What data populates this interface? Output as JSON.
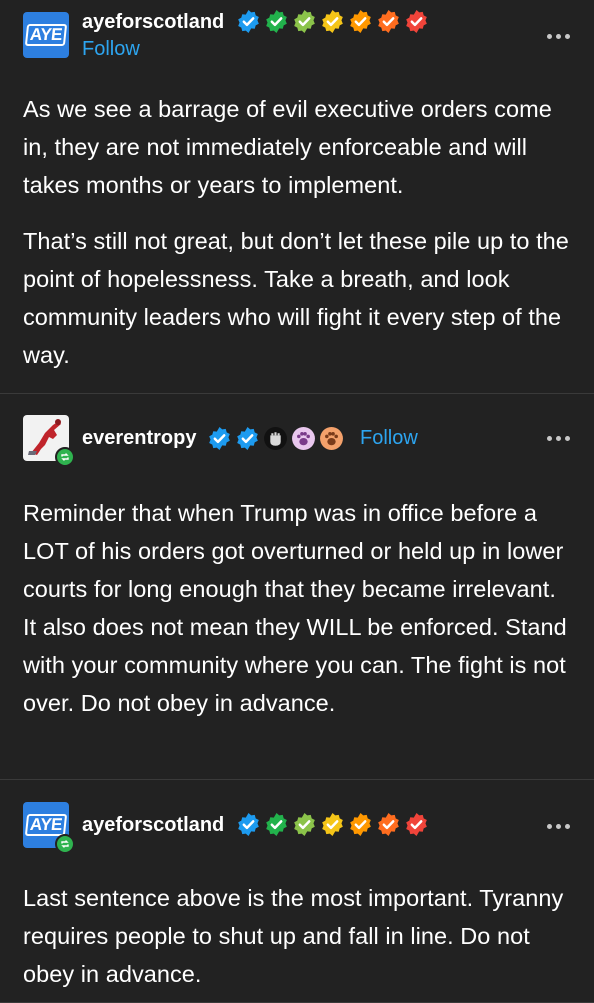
{
  "posts": [
    {
      "username": "ayeforscotland",
      "avatar_text": "AYE",
      "follow_label": "Follow",
      "badges": [
        "verified-blue-badge",
        "green-check-badge",
        "lime-check-badge",
        "yellow-check-badge",
        "orange-check-badge",
        "deep-orange-check-badge",
        "red-check-badge"
      ],
      "paragraphs": [
        "As we see a barrage of evil executive orders come in, they are not immediately enforceable and will takes months or years to implement.",
        "That’s still not great, but don’t let these pile up to the point of hopelessness. Take a breath, and look community leaders who will fight it every step of the way."
      ]
    },
    {
      "username": "everentropy",
      "follow_label": "Follow",
      "badges": [
        "verified-blue-badge",
        "verified-blue-badge",
        "fist-badge",
        "paw-badge",
        "paw-orange-badge"
      ],
      "paragraphs": [
        "Reminder that when Trump was in office before a LOT of his orders got overturned or held up in lower courts for long enough that they became irrelevant. It also does not mean they WILL be enforced. Stand with your community where you can. The fight is not over. Do not obey in advance."
      ]
    },
    {
      "username": "ayeforscotland",
      "avatar_text": "AYE",
      "badges": [
        "verified-blue-badge",
        "green-check-badge",
        "lime-check-badge",
        "yellow-check-badge",
        "orange-check-badge",
        "deep-orange-check-badge",
        "red-check-badge"
      ],
      "paragraphs": [
        "Last sentence above is the most important. Tyranny requires people to shut up and fall in line. Do not obey in advance."
      ]
    }
  ],
  "colors": {
    "background": "#222222",
    "text": "#ffffff",
    "follow": "#2da5f0",
    "blue": "#1d9bf0",
    "green": "#22b24c",
    "lime": "#8bc34a",
    "yellow": "#f5c518",
    "orange": "#ff9800",
    "deep_orange": "#ff6d1f",
    "red": "#f0443a",
    "avatar_blue": "#2d7fe0",
    "reblog_green": "#2fb34f"
  }
}
